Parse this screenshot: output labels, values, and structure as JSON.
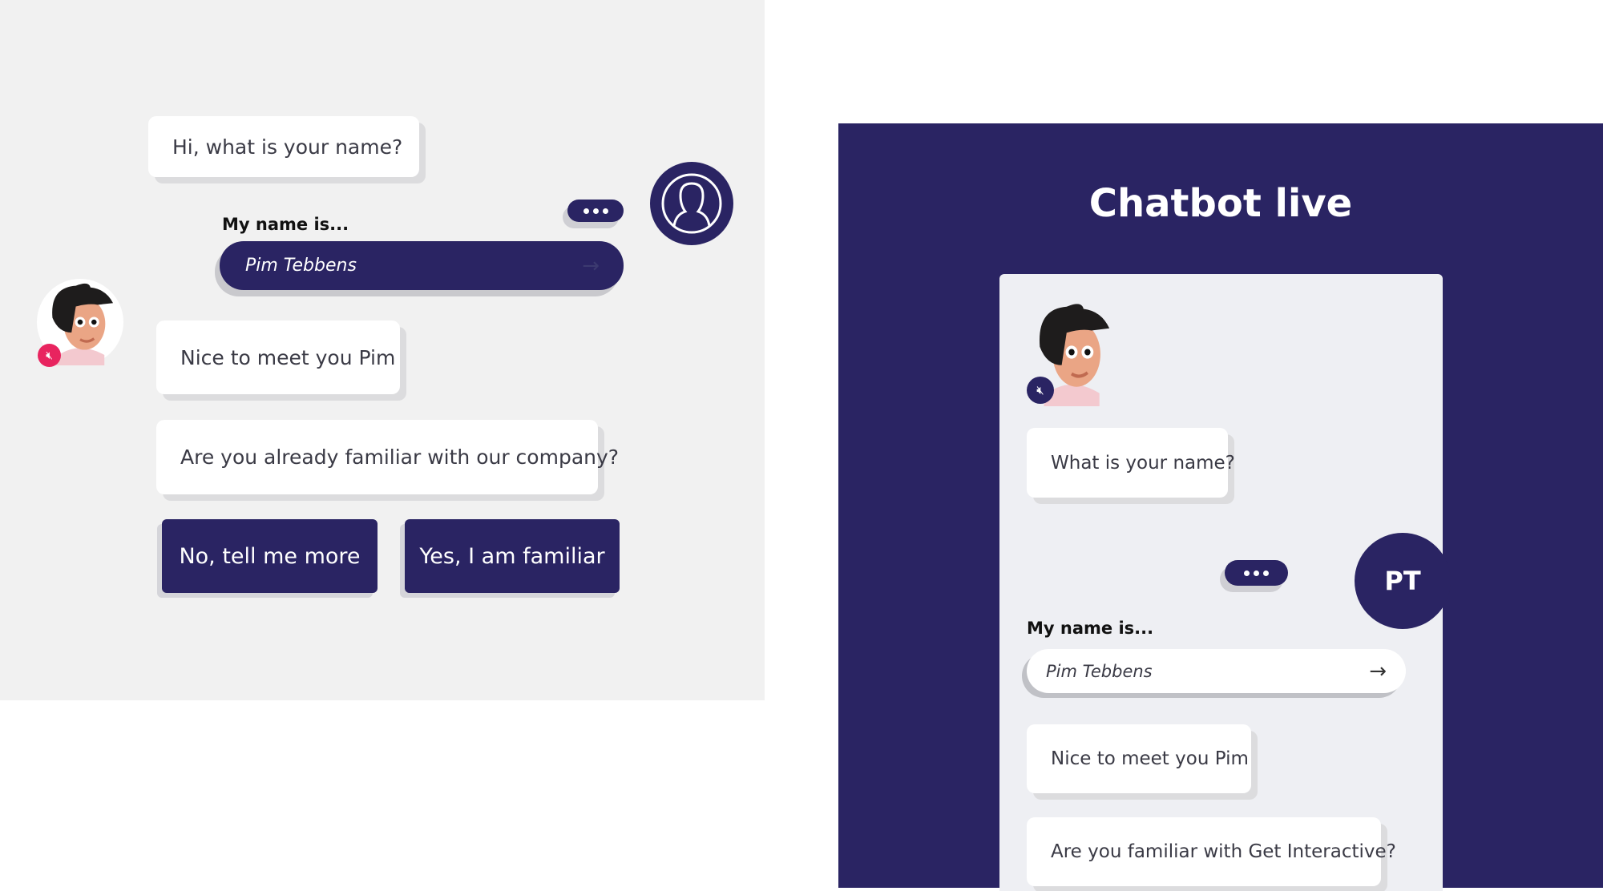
{
  "left": {
    "bot_question": "Hi, what is your name?",
    "name_label": "My name is...",
    "name_input": "Pim Tebbens",
    "reply1": "Nice to meet you Pim",
    "reply2": "Are you already familiar with our company?",
    "buttons": [
      "No, tell me more",
      "Yes, I am familiar"
    ],
    "mute_color": "#e8245f"
  },
  "right": {
    "title": "Chatbot live",
    "bot_question": "What is your name?",
    "user_initials": "PT",
    "name_label": "My name is...",
    "name_input": "Pim Tebbens",
    "reply1": "Nice to meet you Pim",
    "reply2": "Are you familiar with Get Interactive?"
  },
  "colors": {
    "brand": "#2a2463",
    "panel_bg": "#f1f1f1",
    "card_bg": "#eeeff3"
  }
}
